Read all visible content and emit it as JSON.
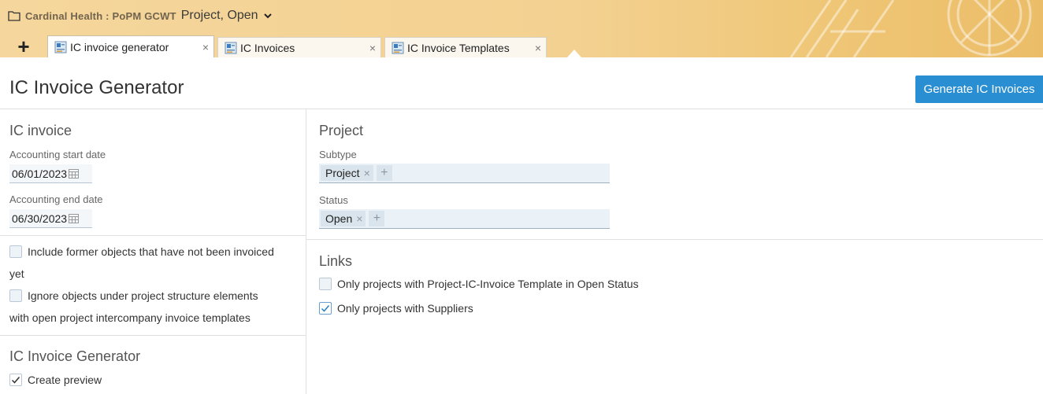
{
  "header": {
    "breadcrumb_redacted": "Cardinal Health : PoPM GCWT",
    "breadcrumb_text": "Project, Open",
    "icons": {
      "folder": "folder-icon",
      "caret": "chevron-down-icon"
    }
  },
  "tabs": {
    "add_label": "+",
    "items": [
      {
        "label": "IC invoice generator",
        "close": "×"
      },
      {
        "label": "IC Invoices",
        "close": "×"
      },
      {
        "label": "IC Invoice Templates",
        "close": "×"
      }
    ]
  },
  "page": {
    "title": "IC Invoice Generator",
    "generate_label": "Generate IC Invoices"
  },
  "ic_invoice": {
    "title": "IC invoice",
    "start_label": "Accounting start date",
    "start_value": "06/01/2023",
    "end_label": "Accounting end date",
    "end_value": "06/30/2023"
  },
  "options": {
    "include_former_line1": "Include former objects that have not been invoiced",
    "include_former_line2": "yet",
    "include_former_checked": false,
    "ignore_objects_line1": "Ignore objects under project structure elements",
    "ignore_objects_line2": "with open project intercompany invoice templates",
    "ignore_objects_checked": false
  },
  "generator": {
    "title": "IC Invoice Generator",
    "preview_label": "Create preview",
    "preview_checked": true
  },
  "project": {
    "title": "Project",
    "subtype_label": "Subtype",
    "subtype_tag": "Project",
    "status_label": "Status",
    "status_tag": "Open",
    "tag_remove": "×",
    "tag_add": "+"
  },
  "links": {
    "title": "Links",
    "template_open_label": "Only projects with Project-IC-Invoice Template in Open Status",
    "template_open_checked": false,
    "suppliers_label": "Only projects with Suppliers",
    "suppliers_checked": true
  },
  "colors": {
    "accent": "#2a8fd2",
    "header": "#f3d191"
  }
}
